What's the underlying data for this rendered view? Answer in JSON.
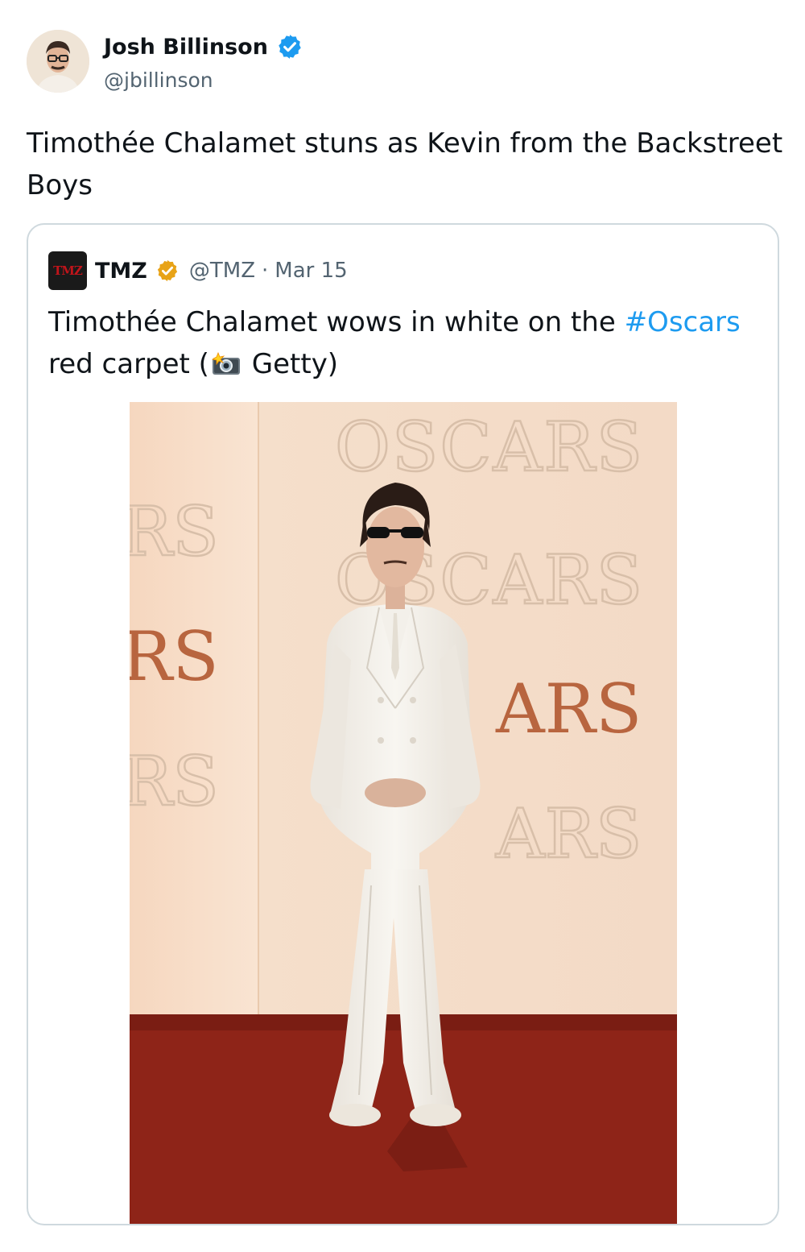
{
  "author": {
    "name": "Josh Billinson",
    "handle": "@jbillinson",
    "avatar_icon": "person-avatar",
    "verified_color": "#1d9bf0"
  },
  "tweet": {
    "text": "Timothée Chalamet stuns as Kevin from the Backstreet Boys"
  },
  "quote": {
    "logo_text": "TMZ",
    "name": "TMZ",
    "handle": "@TMZ",
    "separator": "·",
    "date": "Mar 15",
    "text_before": "Timothée Chalamet wows in white on the ",
    "hashtag": "#Oscars",
    "text_middle": " red carpet (",
    "camera_icon": "camera-flash-icon",
    "text_after": " Getty)",
    "badge_color": "#e8a317",
    "hashtag_color": "#1d9bf0"
  },
  "photo": {
    "backdrop_texts": [
      "OSCARS",
      "RS",
      "OSCARS",
      "RS",
      "ARS",
      "RS",
      "ARS"
    ],
    "carpet_color": "#8e2418",
    "backdrop_color": "#f2dcc8"
  }
}
